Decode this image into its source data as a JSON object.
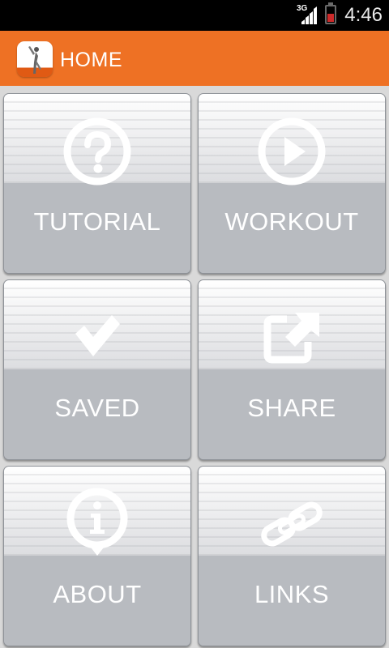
{
  "status_bar": {
    "network": "3G",
    "time": "4:46",
    "battery_color": "#cc2a2a"
  },
  "action_bar": {
    "title": "HOME",
    "icon": "stretching-figure-icon",
    "background": "#ee7124"
  },
  "tiles": [
    {
      "label": "TUTORIAL",
      "icon": "question-circle-icon"
    },
    {
      "label": "WORKOUT",
      "icon": "play-circle-icon"
    },
    {
      "label": "SAVED",
      "icon": "checkmark-icon"
    },
    {
      "label": "SHARE",
      "icon": "share-external-icon"
    },
    {
      "label": "ABOUT",
      "icon": "info-bubble-icon"
    },
    {
      "label": "LINKS",
      "icon": "chain-link-icon"
    }
  ]
}
